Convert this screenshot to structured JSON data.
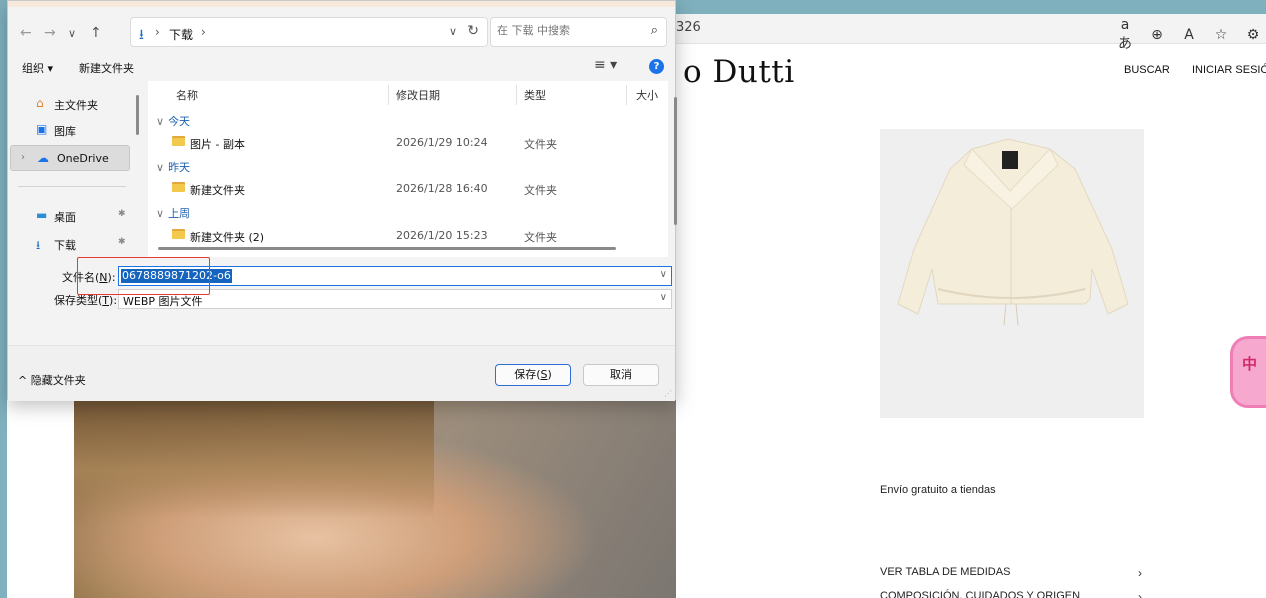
{
  "browser": {
    "address_fragment": "326",
    "icons": [
      "translate-icon",
      "zoom-icon",
      "read-aloud-icon",
      "favorite-icon",
      "extensions-icon"
    ],
    "icon_glyphs": [
      "aあ",
      "⊕",
      "A",
      "☆",
      "⚙"
    ]
  },
  "site": {
    "brand": "o Dutti",
    "nav": {
      "search": "BUSCAR",
      "login": "INICIAR SESIÓ"
    },
    "shipping": "Envío gratuito a tiendas",
    "links": [
      "VER TABLA DE MEDIDAS",
      "COMPOSICIÓN, CUIDADOS Y ORIGEN"
    ],
    "ime_badge": "中"
  },
  "dialog": {
    "path": {
      "location": "下载"
    },
    "search_placeholder": "在 下载 中搜索",
    "toolbar": {
      "organize": "组织 ▾",
      "new_folder": "新建文件夹"
    },
    "nav_pane": [
      {
        "label": "主文件夹",
        "icon": "home-icon"
      },
      {
        "label": "图库",
        "icon": "gallery-icon"
      },
      {
        "label": "OneDrive",
        "icon": "cloud-icon",
        "selected": true
      },
      {
        "label": "桌面",
        "icon": "desktop-icon",
        "pinned": true
      },
      {
        "label": "下载",
        "icon": "download-icon",
        "pinned": true
      }
    ],
    "columns": [
      "名称",
      "修改日期",
      "类型",
      "大小"
    ],
    "groups": [
      {
        "title": "今天",
        "files": [
          {
            "name": "图片 - 副本",
            "date": "2026/1/29 10:24",
            "type": "文件夹"
          }
        ]
      },
      {
        "title": "昨天",
        "files": [
          {
            "name": "新建文件夹",
            "date": "2026/1/28 16:40",
            "type": "文件夹"
          }
        ]
      },
      {
        "title": "上周",
        "files": [
          {
            "name": "新建文件夹 (2)",
            "date": "2026/1/20 15:23",
            "type": "文件夹"
          }
        ]
      }
    ],
    "filename": {
      "label_prefix": "文件名(",
      "hotkey": "N",
      "label_suffix": "):",
      "selected": "0678889871202",
      "rest": "-o6"
    },
    "filetype": {
      "label_prefix": "保存类型(",
      "hotkey": "T",
      "label_suffix": "):",
      "value": "WEBP 图片文件"
    },
    "footer": {
      "hide_folders": "^ 隐藏文件夹",
      "save": {
        "prefix": "保存(",
        "hotkey": "S",
        "suffix": ")"
      },
      "cancel": "取消"
    }
  },
  "colors": {
    "accent": "#1a73e8",
    "highlight": "#e53935",
    "folder": "#f2c94c"
  }
}
